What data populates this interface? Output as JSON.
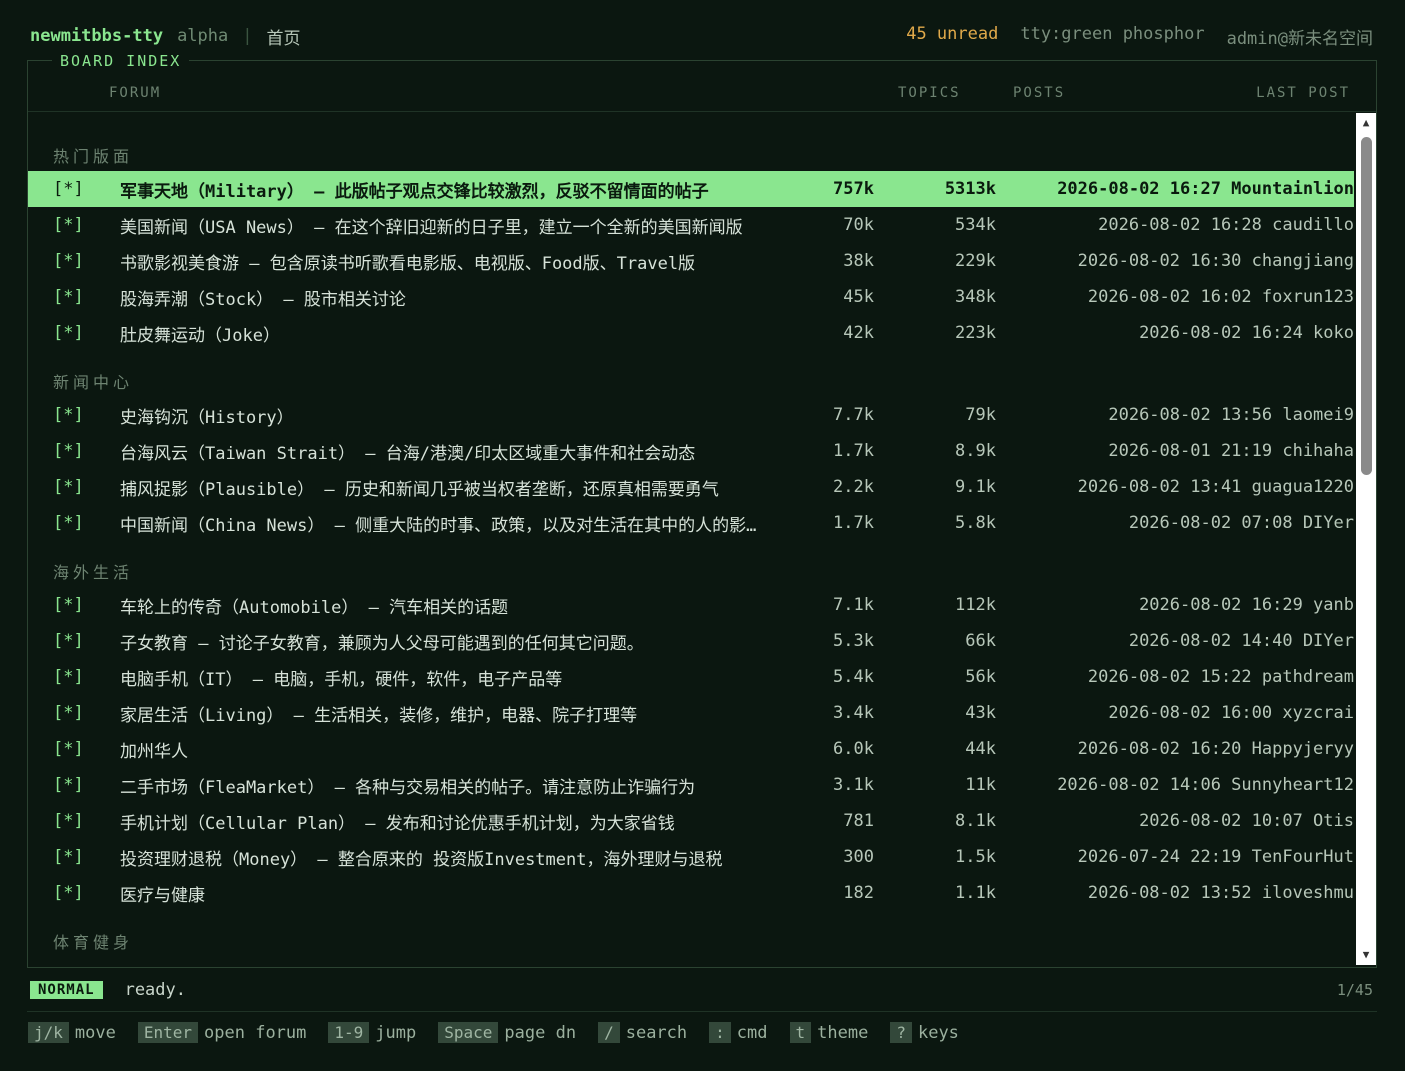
{
  "topbar": {
    "brand": "newmitbbs-tty",
    "alpha": "alpha",
    "crumb": "首页",
    "unread": "45 unread",
    "theme": "tty:green phosphor",
    "user": "admin@新未名空间"
  },
  "panel": {
    "title": "BOARD INDEX",
    "columns": {
      "forum": "FORUM",
      "topics": "TOPICS",
      "posts": "POSTS",
      "last": "LAST POST"
    }
  },
  "sections": [
    {
      "name": "热门版面",
      "rows": [
        {
          "mark": "[*]",
          "name": "军事天地（Military）",
          "desc": " — 此版帖子观点交锋比较激烈，反驳不留情面的帖子",
          "topics": "757k",
          "posts": "5313k",
          "last": "2026-08-02 16:27 Mountainlion",
          "selected": true
        },
        {
          "mark": "[*]",
          "name": "美国新闻（USA News）",
          "desc": " — 在这个辞旧迎新的日子里，建立一个全新的美国新闻版",
          "topics": "70k",
          "posts": "534k",
          "last": "2026-08-02 16:28 caudillo"
        },
        {
          "mark": "[*]",
          "name": "书歌影视美食游",
          "desc": " — 包含原读书听歌看电影版、电视版、Food版、Travel版",
          "topics": "38k",
          "posts": "229k",
          "last": "2026-08-02 16:30 changjiang"
        },
        {
          "mark": "[*]",
          "name": "股海弄潮（Stock）",
          "desc": " — 股市相关讨论",
          "topics": "45k",
          "posts": "348k",
          "last": "2026-08-02 16:02 foxrun123"
        },
        {
          "mark": "[*]",
          "name": "肚皮舞运动（Joke）",
          "desc": "",
          "topics": "42k",
          "posts": "223k",
          "last": "2026-08-02 16:24 koko"
        }
      ]
    },
    {
      "name": "新闻中心",
      "rows": [
        {
          "mark": "[*]",
          "name": "史海钩沉（History）",
          "desc": "",
          "topics": "7.7k",
          "posts": "79k",
          "last": "2026-08-02 13:56 laomei9"
        },
        {
          "mark": "[*]",
          "name": "台海风云（Taiwan Strait）",
          "desc": " — 台海/港澳/印太区域重大事件和社会动态",
          "topics": "1.7k",
          "posts": "8.9k",
          "last": "2026-08-01 21:19 chihaha"
        },
        {
          "mark": "[*]",
          "name": "捕风捉影（Plausible）",
          "desc": " — 历史和新闻几乎被当权者垄断，还原真相需要勇气",
          "topics": "2.2k",
          "posts": "9.1k",
          "last": "2026-08-02 13:41 guagua1220"
        },
        {
          "mark": "[*]",
          "name": "中国新闻（China News）",
          "desc": " — 侧重大陆的时事、政策，以及对生活在其中的人的影响",
          "topics": "1.7k",
          "posts": "5.8k",
          "last": "2026-08-02 07:08 DIYer"
        }
      ]
    },
    {
      "name": "海外生活",
      "rows": [
        {
          "mark": "[*]",
          "name": "车轮上的传奇（Automobile）",
          "desc": " — 汽车相关的话题",
          "topics": "7.1k",
          "posts": "112k",
          "last": "2026-08-02 16:29 yanb"
        },
        {
          "mark": "[*]",
          "name": "子女教育",
          "desc": " — 讨论子女教育，兼顾为人父母可能遇到的任何其它问题。",
          "topics": "5.3k",
          "posts": "66k",
          "last": "2026-08-02 14:40 DIYer"
        },
        {
          "mark": "[*]",
          "name": "电脑手机（IT）",
          "desc": " — 电脑，手机，硬件，软件，电子产品等",
          "topics": "5.4k",
          "posts": "56k",
          "last": "2026-08-02 15:22 pathdream"
        },
        {
          "mark": "[*]",
          "name": "家居生活（Living）",
          "desc": " — 生活相关，装修，维护，电器、院子打理等",
          "topics": "3.4k",
          "posts": "43k",
          "last": "2026-08-02 16:00 xyzcrai"
        },
        {
          "mark": "[*]",
          "name": "加州华人",
          "desc": "",
          "topics": "6.0k",
          "posts": "44k",
          "last": "2026-08-02 16:20 Happyjeryy"
        },
        {
          "mark": "[*]",
          "name": "二手市场（FleaMarket）",
          "desc": " — 各种与交易相关的帖子。请注意防止诈骗行为",
          "topics": "3.1k",
          "posts": "11k",
          "last": "2026-08-02 14:06 Sunnyheart12"
        },
        {
          "mark": "[*]",
          "name": "手机计划（Cellular Plan）",
          "desc": " — 发布和讨论优惠手机计划，为大家省钱",
          "topics": "781",
          "posts": "8.1k",
          "last": "2026-08-02 10:07 Otis"
        },
        {
          "mark": "[*]",
          "name": "投资理财退税（Money）",
          "desc": " — 整合原来的 投资版Investment，海外理财与退税",
          "topics": "300",
          "posts": "1.5k",
          "last": "2026-07-24 22:19 TenFourHut"
        },
        {
          "mark": "[*]",
          "name": "医疗与健康",
          "desc": "",
          "topics": "182",
          "posts": "1.1k",
          "last": "2026-08-02 13:52 iloveshmu"
        }
      ]
    },
    {
      "name": "体育健身",
      "rows": []
    }
  ],
  "status": {
    "mode": "NORMAL",
    "message": "ready.",
    "position": "1/45"
  },
  "keys": [
    {
      "key": "j/k",
      "label": "move"
    },
    {
      "key": "Enter",
      "label": "open forum"
    },
    {
      "key": "1-9",
      "label": "jump"
    },
    {
      "key": "Space",
      "label": "page dn"
    },
    {
      "key": "/",
      "label": "search"
    },
    {
      "key": ":",
      "label": "cmd"
    },
    {
      "key": "t",
      "label": "theme"
    },
    {
      "key": "?",
      "label": "keys"
    }
  ],
  "colors": {
    "accent": "#8ae68f",
    "background": "#0b1710",
    "unread": "#e0a94a"
  }
}
